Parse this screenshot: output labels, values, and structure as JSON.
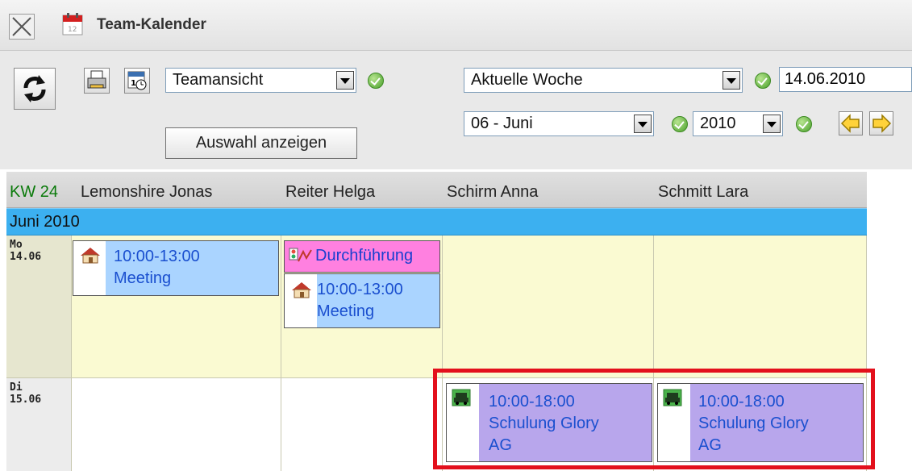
{
  "window": {
    "title": "Team-Kalender"
  },
  "toolbar": {
    "view_select": "Teamansicht",
    "show_selection_button": "Auswahl anzeigen",
    "range_select": "Aktuelle Woche",
    "date_value": "14.06.2010",
    "month_select": "06 - Juni",
    "year_select": "2010"
  },
  "calendar": {
    "week_label": "KW 24",
    "people": [
      "Lemonshire Jonas",
      "Reiter Helga",
      "Schirm Anna",
      "Schmitt Lara"
    ],
    "month_banner": "Juni 2010",
    "days": [
      {
        "dow": "Mo",
        "date": "14.06"
      },
      {
        "dow": "Di",
        "date": "15.06"
      }
    ],
    "events": {
      "e1": {
        "time": "10:00-13:00",
        "title": "Meeting"
      },
      "e2": {
        "title": "Durchführung"
      },
      "e3": {
        "time": "10:00-13:00",
        "title": "Meeting"
      },
      "e4": {
        "time": "10:00-18:00",
        "title_line1": "Schulung Glory",
        "title_line2": "AG"
      },
      "e5": {
        "time": "10:00-18:00",
        "title_line1": "Schulung Glory",
        "title_line2": "AG"
      }
    }
  },
  "colors": {
    "today_row": "#fafad2",
    "month_banner": "#3cb0f0",
    "event_blue": "#aad4ff",
    "event_purple": "#b8a6ec",
    "event_pink": "#ff80e0",
    "highlight": "#e3101c"
  }
}
